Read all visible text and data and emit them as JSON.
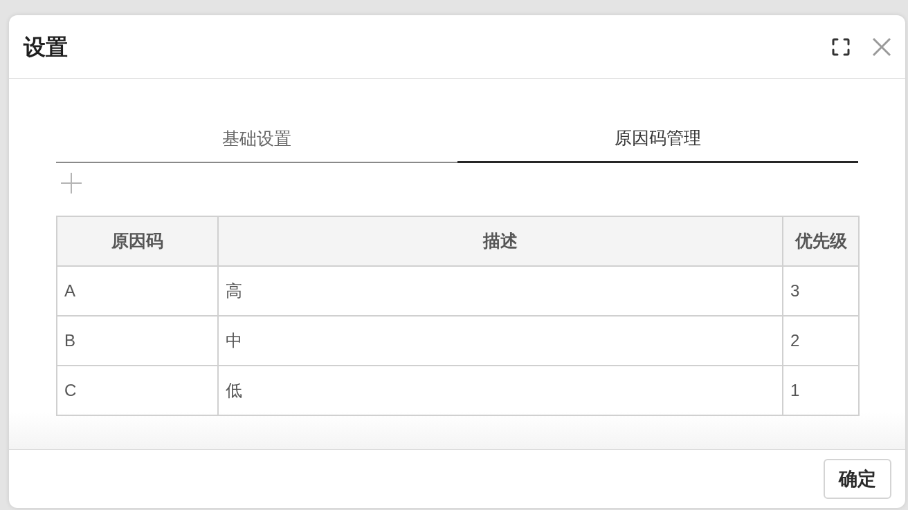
{
  "dialog": {
    "title": "设置"
  },
  "tabs": [
    {
      "label": "基础设置",
      "selected": false
    },
    {
      "label": "原因码管理",
      "selected": true
    }
  ],
  "table": {
    "columns": [
      "原因码",
      "描述",
      "优先级"
    ],
    "rows": [
      [
        "A",
        "高",
        "3"
      ],
      [
        "B",
        "中",
        "2"
      ],
      [
        "C",
        "低",
        "1"
      ]
    ]
  },
  "footer": {
    "buttons": [
      "确定"
    ]
  }
}
